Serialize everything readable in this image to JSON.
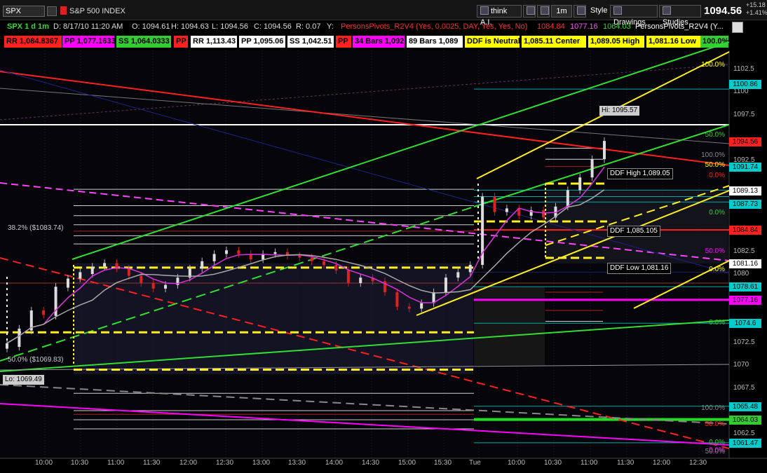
{
  "toolbar": {
    "symbol": "SPX",
    "symbol_name": "S&P 500 INDEX",
    "change_pts": "+15.18",
    "change_pct": "+1.41%",
    "last_price": "1094.56",
    "buttons": [
      "think A.I.",
      "1m",
      "Style",
      "Drawings",
      "Studies"
    ]
  },
  "info": {
    "title": "SPX 1 d 1m",
    "date": "D: 8/17/10 11:20 AM",
    "open": "O: 1094.61",
    "high": "H: 1094.63",
    "low": "L: 1094.56",
    "close": "C: 1094.56",
    "range": "R: 0.07",
    "y": "Y:",
    "study": "PersonsPivots_R2V4 (Yes, 0.0025, DAY, Yes, Yes, No)",
    "v1": "1084.84",
    "v2": "1077.16",
    "v3": "1064.03",
    "study2": "PersonsPivots_R2V4 (Y..."
  },
  "bubbles": [
    {
      "text": "RR 1,084.8367",
      "bg": "#ff2020",
      "fg": "#000000"
    },
    {
      "text": "PP 1,077.1633",
      "bg": "#ff00ff",
      "fg": "#000000"
    },
    {
      "text": "SS 1,064.0333",
      "bg": "#33cc33",
      "fg": "#000000"
    },
    {
      "text": "PP",
      "bg": "#ff2020",
      "fg": "#000000"
    },
    {
      "text": "RR 1,113.43",
      "bg": "#ffffff",
      "fg": "#000000"
    },
    {
      "text": "PP 1,095.06",
      "bg": "#ffffff",
      "fg": "#000000"
    },
    {
      "text": "SS 1,042.51",
      "bg": "#ffffff",
      "fg": "#000000"
    },
    {
      "text": "PP",
      "bg": "#ff2020",
      "fg": "#000000"
    },
    {
      "text": "34 Bars 1,092",
      "bg": "#ff00ff",
      "fg": "#000000"
    },
    {
      "text": "89 Bars 1,089",
      "bg": "#ffffff",
      "fg": "#000000"
    },
    {
      "text": "DDF is Neutral",
      "bg": "#ffff00",
      "fg": "#000000"
    },
    {
      "text": "1,085.11 Center",
      "bg": "#ffff00",
      "fg": "#000000"
    },
    {
      "text": "1,089.05 High",
      "bg": "#ffff00",
      "fg": "#000000"
    },
    {
      "text": "1,081.16 Low",
      "bg": "#ffff00",
      "fg": "#000000"
    },
    {
      "text": "100.0%",
      "bg": "#33cc33",
      "fg": "#000000"
    }
  ],
  "price_axis": [
    "1102.5",
    "1100",
    "1097.5",
    "1092.5",
    "1082.5",
    "1080",
    "1072.5",
    "1070",
    "1067.5",
    "1062.5"
  ],
  "price_boxes": [
    {
      "text": "1100.86",
      "bg": "#00cccc",
      "fg": "#000000",
      "p": 1100.86
    },
    {
      "text": "1094.56",
      "bg": "#ff2020",
      "fg": "#000000",
      "p": 1094.56
    },
    {
      "text": "1091.74",
      "bg": "#00cccc",
      "fg": "#000000",
      "p": 1091.74
    },
    {
      "text": "1089.13",
      "bg": "#ffffff",
      "fg": "#000000",
      "p": 1089.13
    },
    {
      "text": "1087.73",
      "bg": "#00cccc",
      "fg": "#000000",
      "p": 1087.73
    },
    {
      "text": "1084.84",
      "bg": "#ff2020",
      "fg": "#000000",
      "p": 1084.84
    },
    {
      "text": "1081.16",
      "bg": "#ffffff",
      "fg": "#000000",
      "p": 1081.16
    },
    {
      "text": "1078.61",
      "bg": "#00cccc",
      "fg": "#000000",
      "p": 1078.61
    },
    {
      "text": "1077.16",
      "bg": "#ff00ff",
      "fg": "#000000",
      "p": 1077.16
    },
    {
      "text": "1074.6",
      "bg": "#00cccc",
      "fg": "#000000",
      "p": 1074.6
    },
    {
      "text": "1065.48",
      "bg": "#00cccc",
      "fg": "#000000",
      "p": 1065.48
    },
    {
      "text": "1064.03",
      "bg": "#33cc33",
      "fg": "#000000",
      "p": 1064.03
    },
    {
      "text": "1061.47",
      "bg": "#00cccc",
      "fg": "#000000",
      "p": 1061.47
    }
  ],
  "time_axis": [
    "10:00",
    "10:30",
    "11:00",
    "11:30",
    "12:00",
    "12:30",
    "13:00",
    "13:30",
    "14:00",
    "14:30",
    "15:00",
    "15:30",
    "Tue",
    "10:00",
    "10:30",
    "11:00",
    "11:30",
    "12:00",
    "12:30"
  ],
  "annotations": {
    "hi": "Hi: 1095.57",
    "lo": "Lo: 1069.49",
    "fib_382": "38.2%  ($1083.74)",
    "fib_50": "50.0%  ($1069.83)",
    "ddf_high": "DDF High 1,089.05",
    "ddf_center": "DDF 1,085.105",
    "ddf_low": "DDF Low 1,081.16"
  },
  "fib_labels": [
    {
      "text": "100.0%",
      "color": "#ffff00",
      "p": 1102.9
    },
    {
      "text": "50.0%",
      "color": "#33cc33",
      "p": 1095.2
    },
    {
      "text": "100.0%",
      "color": "#888888",
      "p": 1093.0
    },
    {
      "text": "50.0%",
      "color": "#ffff00",
      "p": 1091.9
    },
    {
      "text": "0.0%",
      "color": "#ff2020",
      "p": 1090.8
    },
    {
      "text": "0.0%",
      "color": "#33cc33",
      "p": 1086.7
    },
    {
      "text": "50.0%",
      "color": "#ff00ff",
      "p": 1082.5
    },
    {
      "text": "0.0%",
      "color": "#ffff00",
      "p": 1080.5
    },
    {
      "text": "0.0%",
      "color": "#33cc33",
      "p": 1074.6
    },
    {
      "text": "100.0%",
      "color": "#888888",
      "p": 1065.2
    },
    {
      "text": "50.0%",
      "color": "#ff2020",
      "p": 1063.5
    },
    {
      "text": "0.0%",
      "color": "#33cc33",
      "p": 1061.5
    },
    {
      "text": "0.0%",
      "color": "#ff00ff",
      "p": 1060.6
    },
    {
      "text": "50.0%",
      "color": "#888888",
      "p": 1060.5
    }
  ],
  "candles": [
    [
      1071.8,
      1072.4
    ],
    [
      1072.0,
      1074.0
    ],
    [
      1073.8,
      1076.0
    ],
    [
      1076.0,
      1075.5
    ],
    [
      1075.4,
      1078.6
    ],
    [
      1078.5,
      1079.5
    ],
    [
      1079.5,
      1080.2
    ],
    [
      1080.0,
      1080.8
    ],
    [
      1080.8,
      1081.2
    ],
    [
      1081.2,
      1080.6
    ],
    [
      1080.6,
      1079.8
    ],
    [
      1079.8,
      1079.0
    ],
    [
      1079.0,
      1078.4
    ],
    [
      1078.4,
      1078.8
    ],
    [
      1078.8,
      1079.6
    ],
    [
      1079.6,
      1080.6
    ],
    [
      1080.6,
      1081.4
    ],
    [
      1081.4,
      1082.2
    ],
    [
      1082.2,
      1082.6
    ],
    [
      1082.6,
      1082.2
    ],
    [
      1082.2,
      1081.6
    ],
    [
      1081.6,
      1082.2
    ],
    [
      1082.2,
      1082.4
    ],
    [
      1082.4,
      1082.0
    ],
    [
      1082.0,
      1081.8
    ],
    [
      1081.8,
      1081.4
    ],
    [
      1081.4,
      1081.0
    ],
    [
      1081.0,
      1080.4
    ],
    [
      1080.4,
      1079.0
    ],
    [
      1079.0,
      1079.6
    ],
    [
      1079.6,
      1079.2
    ],
    [
      1079.2,
      1078.0
    ],
    [
      1078.0,
      1076.4
    ],
    [
      1076.4,
      1076.2
    ],
    [
      1076.2,
      1076.8
    ],
    [
      1076.8,
      1078.0
    ],
    [
      1078.0,
      1079.6
    ],
    [
      1079.6,
      1080.2
    ],
    [
      1080.2,
      1081.0
    ],
    [
      1081.0,
      1088.5
    ],
    [
      1088.5,
      1086.8
    ],
    [
      1086.8,
      1087.2
    ],
    [
      1087.2,
      1086.4
    ],
    [
      1086.4,
      1087.0
    ],
    [
      1087.0,
      1086.2
    ],
    [
      1086.2,
      1087.4
    ],
    [
      1087.4,
      1089.2
    ],
    [
      1089.2,
      1090.6
    ],
    [
      1090.6,
      1092.6
    ],
    [
      1092.6,
      1094.6
    ]
  ]
}
